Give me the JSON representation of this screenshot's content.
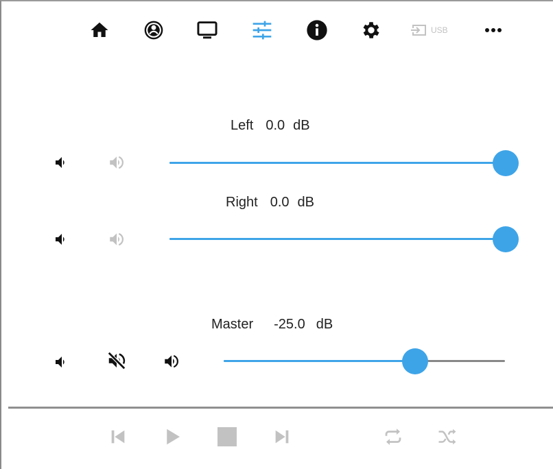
{
  "nav": {
    "items": [
      {
        "name": "home",
        "icon": "home-icon"
      },
      {
        "name": "profile",
        "icon": "account-circle-icon"
      },
      {
        "name": "display",
        "icon": "monitor-icon"
      },
      {
        "name": "equalizer",
        "icon": "sliders-icon",
        "active": true
      },
      {
        "name": "info",
        "icon": "info-icon"
      },
      {
        "name": "settings",
        "icon": "gear-icon"
      },
      {
        "name": "usb",
        "icon": "input-icon",
        "label": "USB",
        "disabled": true
      },
      {
        "name": "more",
        "icon": "more-horizontal-icon"
      }
    ],
    "active_color": "#3ea4e8",
    "disabled_color": "#c2c2c2"
  },
  "channels": {
    "left": {
      "name": "Left",
      "value": "0.0",
      "unit": "dB",
      "level": 1.0
    },
    "right": {
      "name": "Right",
      "value": "0.0",
      "unit": "dB",
      "level": 1.0
    },
    "master": {
      "name": "Master",
      "value": "-25.0",
      "unit": "dB",
      "level": 0.68
    }
  },
  "volume_icons": {
    "left": [
      "volume-down-icon",
      "volume-up-icon"
    ],
    "right": [
      "volume-down-icon",
      "volume-up-icon"
    ],
    "master": [
      "volume-down-icon",
      "mute-icon",
      "volume-up-icon"
    ]
  },
  "transport": {
    "buttons": [
      "previous-icon",
      "play-icon",
      "stop-icon",
      "next-icon",
      "repeat-icon",
      "shuffle-icon"
    ],
    "color": "#c2c2c2"
  },
  "colors": {
    "accent": "#3ea4e8",
    "rail": "#888888",
    "icon_dark": "#111111",
    "icon_muted": "#c2c2c2"
  }
}
